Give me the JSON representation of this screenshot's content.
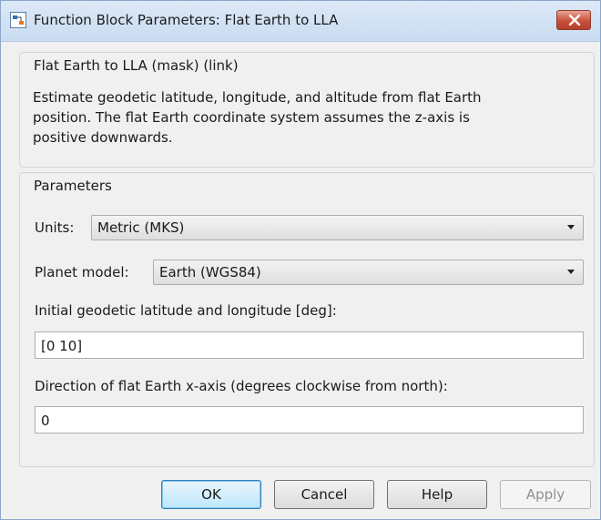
{
  "window": {
    "title": "Function Block Parameters: Flat Earth to LLA",
    "app_icon": "simulink-block-icon",
    "close_icon": "close-icon"
  },
  "description_group": {
    "title": "Flat Earth to LLA (mask) (link)",
    "lines": [
      "Estimate geodetic latitude, longitude, and altitude from flat Earth",
      "position.  The flat Earth coordinate system assumes the z-axis is",
      "positive downwards."
    ]
  },
  "parameters_group": {
    "title": "Parameters",
    "units": {
      "label": "Units:",
      "selected": "Metric (MKS)"
    },
    "planet_model": {
      "label": "Planet model:",
      "selected": "Earth (WGS84)"
    },
    "initial_lat_lon": {
      "label": "Initial geodetic latitude and longitude [deg]:",
      "value": "[0 10]"
    },
    "x_axis_direction": {
      "label": "Direction of flat Earth x-axis (degrees clockwise from north):",
      "value": "0"
    }
  },
  "buttons": {
    "ok": "OK",
    "cancel": "Cancel",
    "help": "Help",
    "apply": "Apply"
  },
  "colors": {
    "close_button": "#c9503c",
    "ok_button_border": "#3c7fb1"
  }
}
